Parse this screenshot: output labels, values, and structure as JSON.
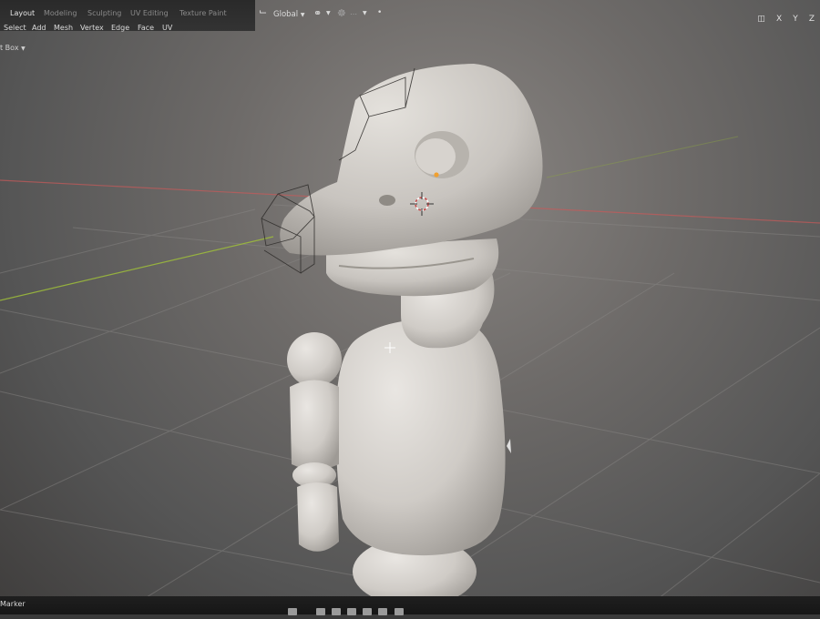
{
  "workspace_tabs": [
    "Layout",
    "Modeling",
    "Sculpting",
    "UV Editing",
    "Texture Paint"
  ],
  "active_tab": "Layout",
  "menus": [
    "Select",
    "Add",
    "Mesh",
    "Vertex",
    "Edge",
    "Face",
    "UV"
  ],
  "tool_label": "t Box",
  "transform_orientation": "Global",
  "bottom": {
    "marker_label": "Marker"
  },
  "colors": {
    "x_axis": "#c85a5a",
    "y_axis": "#9fbf3a",
    "selection": "#f0a030",
    "model": "#d9d6d1"
  },
  "icons": {
    "orientation": "transform-orientation-icon",
    "pivot": "pivot-point-icon",
    "snap": "snap-icon",
    "proportional": "proportional-editing-icon",
    "close": "close-icon"
  }
}
